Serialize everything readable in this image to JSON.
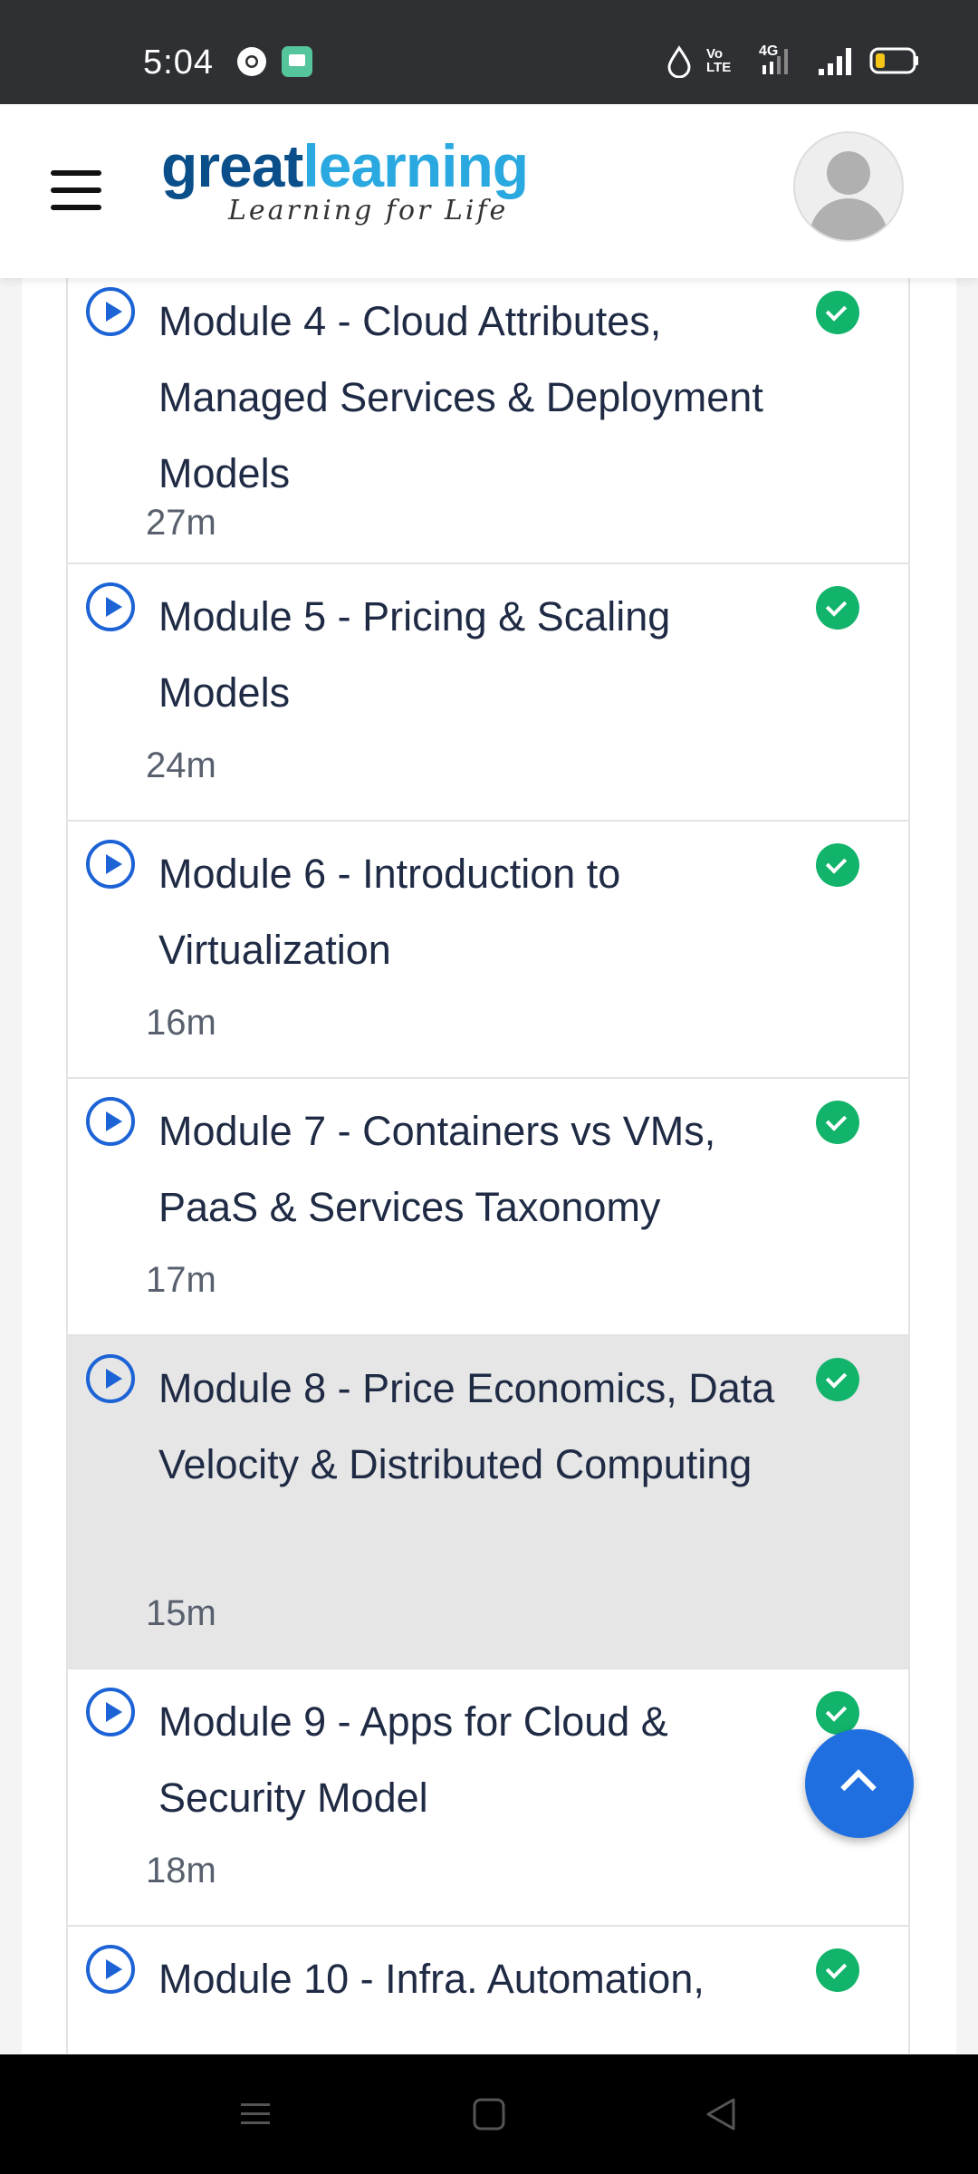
{
  "status_bar": {
    "time": "5:04",
    "icons": [
      "chrome-icon",
      "message-icon",
      "data-saver-icon",
      "volte-icon",
      "4g-signal-icon",
      "signal-icon",
      "battery-icon"
    ],
    "volte_text": "Vo LTE",
    "network_text": "4G"
  },
  "header": {
    "logo_part1": "great",
    "logo_part2": "learning",
    "tagline": "Learning for Life",
    "menu_icon": "hamburger-menu-icon",
    "avatar": "user-avatar"
  },
  "colors": {
    "brand_dark": "#0b4f8a",
    "brand_light": "#2aa8e0",
    "play_blue": "#1c63d6",
    "check_green": "#12b36a",
    "fab_blue": "#1f6fe0"
  },
  "modules": [
    {
      "title": "Module 4 - Cloud Attributes, Managed Services & Deployment Models",
      "duration": "27m",
      "completed": true
    },
    {
      "title": "Module 5 - Pricing & Scaling Models",
      "duration": "24m",
      "completed": true
    },
    {
      "title": "Module 6 - Introduction to Virtualization",
      "duration": "16m",
      "completed": true
    },
    {
      "title": "Module 7 - Containers vs VMs, PaaS & Services Taxonomy",
      "duration": "17m",
      "completed": true
    },
    {
      "title": "Module 8 - Price Economics, Data Velocity & Distributed Computing",
      "duration": "15m",
      "completed": true,
      "active": true
    },
    {
      "title": "Module 9 - Apps for Cloud & Security Model",
      "duration": "18m",
      "completed": true
    },
    {
      "title": "Module 10 - Infra. Automation,",
      "duration": "",
      "completed": true
    }
  ],
  "fab": {
    "icon": "chevron-up-icon"
  },
  "nav_bar": {
    "icons": [
      "recent-apps-icon",
      "home-icon",
      "back-icon"
    ]
  }
}
